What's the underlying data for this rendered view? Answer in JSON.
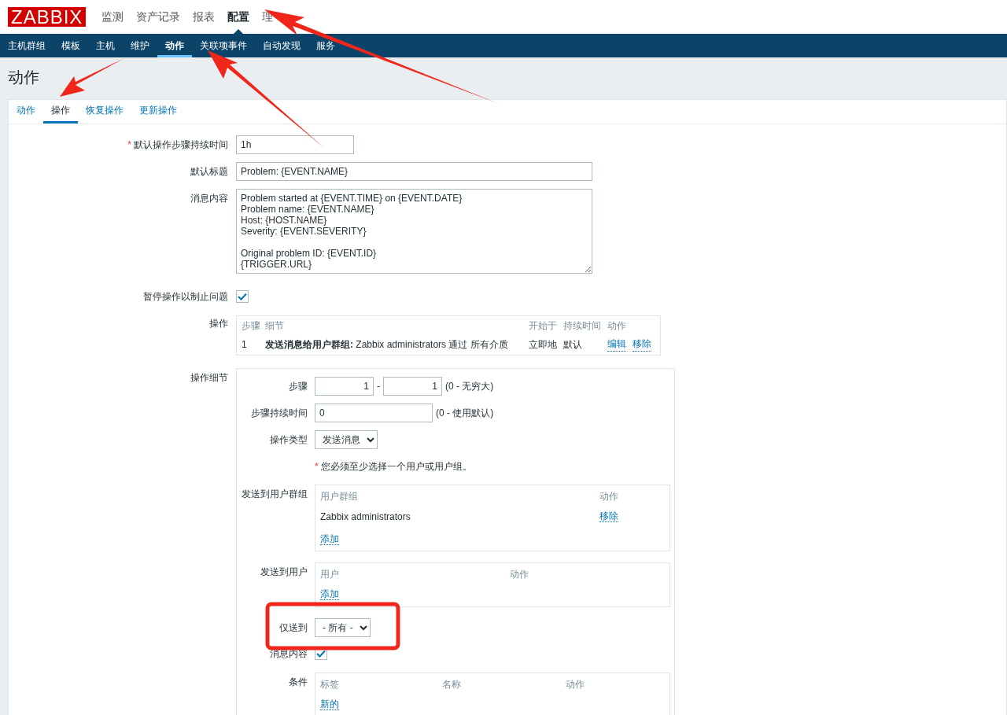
{
  "logo": "ZABBIX",
  "top_menu": [
    {
      "label": "监测",
      "selected": false
    },
    {
      "label": "资产记录",
      "selected": false
    },
    {
      "label": "报表",
      "selected": false
    },
    {
      "label": "配置",
      "selected": true
    },
    {
      "label": "理",
      "selected": false
    }
  ],
  "sub_menu": [
    {
      "label": "主机群组",
      "selected": false
    },
    {
      "label": "模板",
      "selected": false
    },
    {
      "label": "主机",
      "selected": false
    },
    {
      "label": "维护",
      "selected": false
    },
    {
      "label": "动作",
      "selected": true
    },
    {
      "label": "关联项事件",
      "selected": false
    },
    {
      "label": "自动发现",
      "selected": false
    },
    {
      "label": "服务",
      "selected": false
    }
  ],
  "page_title": "动作",
  "tabs": [
    {
      "label": "动作",
      "selected": false
    },
    {
      "label": "操作",
      "selected": true
    },
    {
      "label": "恢复操作",
      "selected": false
    },
    {
      "label": "更新操作",
      "selected": false
    }
  ],
  "form": {
    "default_duration": {
      "label": "默认操作步骤持续时间",
      "required": true,
      "required_mark": "*",
      "value": "1h"
    },
    "default_subject": {
      "label": "默认标题",
      "value": "Problem: {EVENT.NAME}"
    },
    "default_message": {
      "label": "消息内容",
      "value": "Problem started at {EVENT.TIME} on {EVENT.DATE}\nProblem name: {EVENT.NAME}\nHost: {HOST.NAME}\nSeverity: {EVENT.SEVERITY}\n\nOriginal problem ID: {EVENT.ID}\n{TRIGGER.URL}"
    },
    "pause_suppressed": {
      "label": "暂停操作以制止问题",
      "checked": true
    },
    "operations": {
      "label": "操作",
      "columns": [
        "步骤",
        "细节",
        "开始于",
        "持续时间",
        "动作"
      ],
      "rows": [
        {
          "step": "1",
          "detail_bold": "发送消息给用户群组:",
          "detail": "Zabbix administrators 通过 所有介质",
          "start": "立即地",
          "duration": "默认",
          "links": [
            "编辑",
            "移除"
          ]
        }
      ]
    },
    "operation_details": {
      "label": "操作细节",
      "steps": {
        "label": "步骤",
        "from": "1",
        "separator": "-",
        "to": "1",
        "hint": "(0 - 无穷大)"
      },
      "step_duration": {
        "label": "步骤持续时间",
        "value": "0",
        "hint": "(0 - 使用默认)"
      },
      "operation_type": {
        "label": "操作类型",
        "value": "发送消息"
      },
      "warning_mark": "*",
      "warning": "您必须至少选择一个用户或用户组。",
      "user_groups": {
        "label": "发送到用户群组",
        "columns": [
          "用户群组",
          "动作"
        ],
        "rows": [
          {
            "name": "Zabbix administrators",
            "link": "移除"
          }
        ],
        "add": "添加"
      },
      "users": {
        "label": "发送到用户",
        "columns": [
          "用户",
          "动作"
        ],
        "add": "添加"
      },
      "send_only_to": {
        "label": "仅送到",
        "value": "- 所有 -"
      },
      "message_content": {
        "label": "消息内容",
        "checked": true
      },
      "conditions": {
        "label": "条件",
        "columns": [
          "标签",
          "名称",
          "动作"
        ],
        "add": "新的"
      }
    }
  }
}
